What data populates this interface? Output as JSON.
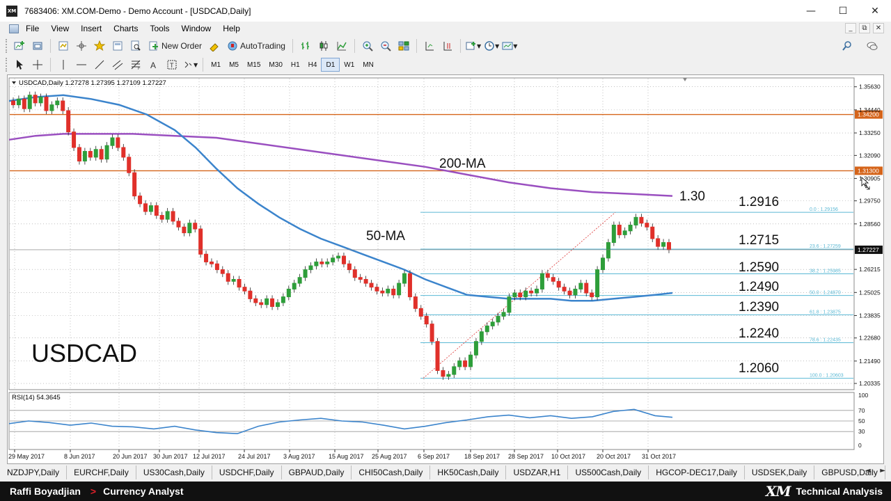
{
  "window": {
    "title": "7683406: XM.COM-Demo - Demo Account - [USDCAD,Daily]",
    "app_icon_text": "XM",
    "controls": [
      "—",
      "☐",
      "✕"
    ]
  },
  "menu": {
    "items": [
      "File",
      "View",
      "Insert",
      "Charts",
      "Tools",
      "Window",
      "Help"
    ],
    "mdi_controls": [
      "_",
      "⧉",
      "✕"
    ]
  },
  "toolbar": {
    "new_order": "New Order",
    "autotrading": "AutoTrading",
    "timeframes": [
      "M1",
      "M5",
      "M15",
      "M30",
      "H1",
      "H4",
      "D1",
      "W1",
      "MN"
    ],
    "active_timeframe": "D1"
  },
  "chart": {
    "header": "USDCAD,Daily  1.27278 1.27395 1.27109 1.27227",
    "symbol_label": "USDCAD",
    "rsi_header": "RSI(14) 54.3645",
    "colors": {
      "bull": "#2e9e3a",
      "bear": "#e0302a",
      "ma50": "#3b84cc",
      "ma200": "#9a4fc0",
      "hline": "#d5641a",
      "fib": "#5ab8d4",
      "grid": "#9a9a9a"
    }
  },
  "chart_data": {
    "type": "candlestick",
    "symbol": "USDCAD",
    "timeframe": "Daily",
    "ohlc_last": {
      "open": 1.27278,
      "high": 1.27395,
      "low": 1.27109,
      "close": 1.27227
    },
    "price_axis": {
      "ticks": [
        "1.35630",
        "1.34440",
        "1.33250",
        "1.32090",
        "1.30905",
        "1.29750",
        "1.28560",
        "1.27227",
        "1.26215",
        "1.25025",
        "1.23835",
        "1.22680",
        "1.21490",
        "1.20335"
      ],
      "current_price": "1.27227",
      "range": [
        1.2005,
        1.3605
      ]
    },
    "date_axis": [
      "29 May 2017",
      "8 Jun 2017",
      "20 Jun 2017",
      "30 Jun 2017",
      "12 Jul 2017",
      "24 Jul 2017",
      "3 Aug 2017",
      "15 Aug 2017",
      "25 Aug 2017",
      "6 Sep 2017",
      "18 Sep 2017",
      "28 Sep 2017",
      "10 Oct 2017",
      "20 Oct 2017",
      "31 Oct 2017"
    ],
    "candles_close": [
      1.347,
      1.35,
      1.345,
      1.352,
      1.348,
      1.351,
      1.344,
      1.347,
      1.349,
      1.344,
      1.333,
      1.325,
      1.318,
      1.323,
      1.32,
      1.324,
      1.319,
      1.326,
      1.33,
      1.325,
      1.32,
      1.312,
      1.3,
      1.296,
      1.292,
      1.295,
      1.29,
      1.288,
      1.292,
      1.287,
      1.284,
      1.281,
      1.286,
      1.283,
      1.27,
      1.266,
      1.265,
      1.262,
      1.26,
      1.256,
      1.257,
      1.253,
      1.251,
      1.247,
      1.245,
      1.244,
      1.247,
      1.243,
      1.245,
      1.248,
      1.252,
      1.255,
      1.258,
      1.262,
      1.264,
      1.266,
      1.265,
      1.266,
      1.268,
      1.269,
      1.265,
      1.262,
      1.258,
      1.257,
      1.255,
      1.253,
      1.251,
      1.25,
      1.252,
      1.249,
      1.255,
      1.26,
      1.248,
      1.242,
      1.238,
      1.234,
      1.225,
      1.21,
      1.207,
      1.208,
      1.212,
      1.215,
      1.212,
      1.218,
      1.225,
      1.23,
      1.233,
      1.235,
      1.238,
      1.24,
      1.248,
      1.25,
      1.248,
      1.251,
      1.25,
      1.252,
      1.26,
      1.258,
      1.256,
      1.253,
      1.251,
      1.249,
      1.252,
      1.255,
      1.25,
      1.248,
      1.262,
      1.268,
      1.276,
      1.285,
      1.28,
      1.282,
      1.285,
      1.289,
      1.286,
      1.284,
      1.278,
      1.274,
      1.276,
      1.2723
    ],
    "moving_averages": [
      {
        "name": "50-MA"
      },
      {
        "name": "200-MA"
      }
    ],
    "horizontal_lines": [
      1.342,
      1.313
    ],
    "horizontal_line_labels": [
      "1.34200",
      "1.31300"
    ],
    "fibonacci_levels": [
      {
        "ratio_label": "0.0 : 1.29156",
        "level": 1.29156
      },
      {
        "ratio_label": "23.6 : 1.27259",
        "level": 1.27259
      },
      {
        "ratio_label": "38.2 : 1.25985",
        "level": 1.25985
      },
      {
        "ratio_label": "50.0 : 1.24870",
        "level": 1.2487
      },
      {
        "ratio_label": "61.8 : 1.23875",
        "level": 1.23875
      },
      {
        "ratio_label": "78.6 : 1.22435",
        "level": 1.22435
      },
      {
        "ratio_label": "100.0 : 1.20603",
        "level": 1.20603
      }
    ],
    "annotations": [
      "1.30",
      "1.2916",
      "1.2715",
      "1.2590",
      "1.2490",
      "1.2390",
      "1.2240",
      "1.2060"
    ],
    "rsi": {
      "period": 14,
      "value": 54.3645,
      "levels": [
        70,
        50,
        30
      ],
      "axis_ticks": [
        "100",
        "70",
        "50",
        "30",
        "0"
      ]
    }
  },
  "symbol_tabs": [
    "NZDJPY,Daily",
    "EURCHF,Daily",
    "US30Cash,Daily",
    "USDCHF,Daily",
    "GBPAUD,Daily",
    "CHI50Cash,Daily",
    "HK50Cash,Daily",
    "USDZAR,H1",
    "US500Cash,Daily",
    "HGCOP-DEC17,Daily",
    "USDSEK,Daily",
    "GBPUSD,Daily"
  ],
  "tab_scroll": [
    "◄",
    "►"
  ],
  "banner": {
    "presenter": "Raffi Boyadjian",
    "arrow": ">",
    "role": "Currency Analyst",
    "brand_logo": "XM",
    "brand_text": "Technical Analysis"
  }
}
